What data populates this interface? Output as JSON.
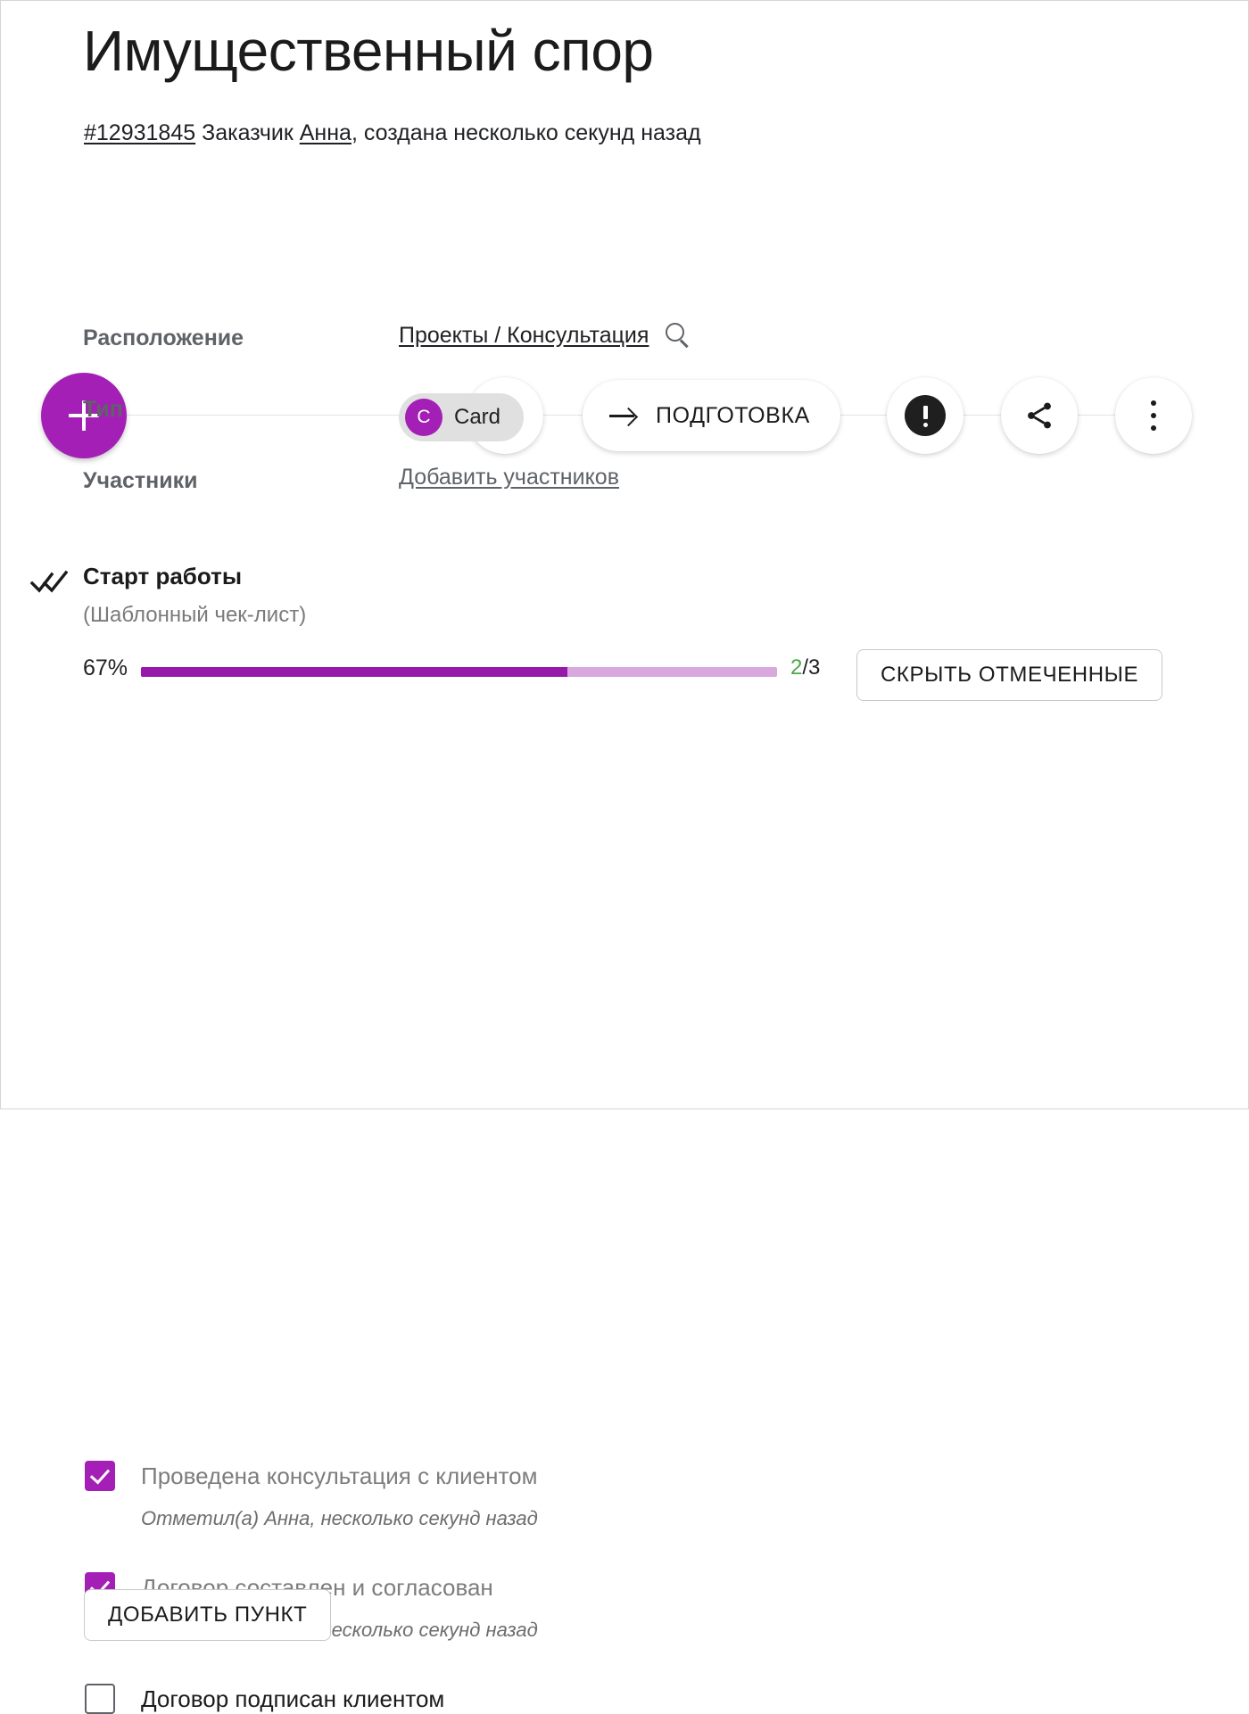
{
  "header": {
    "title": "Имущественный спор",
    "meta": {
      "id": "#12931845",
      "client_label": "Заказчик",
      "client_name": "Анна",
      "created": ", создана несколько секунд назад"
    }
  },
  "actionbar": {
    "add_button_icon": "plus-icon",
    "play_button_icon": "play-icon",
    "stage_button": {
      "icon": "arrow-right-icon",
      "label": "ПОДГОТОВКА"
    },
    "alert_button_icon": "exclamation-circle-icon",
    "share_button_icon": "share-icon",
    "more_button_icon": "more-vertical-icon"
  },
  "fields": [
    {
      "label": "Расположение",
      "value": "Проекты / Консультация",
      "icon": "search-icon"
    },
    {
      "label": "Тип",
      "chip": {
        "initial": "C",
        "label": "Card"
      }
    },
    {
      "label": "Участники",
      "value": "Добавить участников"
    }
  ],
  "checklist": {
    "icon": "double-check-icon",
    "title": "Старт работы",
    "subtitle": "(Шаблонный чек-лист)",
    "progress": {
      "percent_label": "67%",
      "percent_value": 67,
      "done": "2",
      "separator": "/3"
    },
    "hide_checked_label": "СКРЫТЬ ОТМЕЧЕННЫЕ",
    "add_item_label": "ДОБАВИТЬ ПУНКТ",
    "items": [
      {
        "text": "Проведена консультация с клиентом",
        "checked": true,
        "meta": "Отметил(а) Анна, несколько секунд назад"
      },
      {
        "text": "Договор составлен и согласован",
        "checked": true,
        "meta": "Отметил(а) Анна, несколько секунд назад"
      },
      {
        "text": "Договор подписан клиентом",
        "checked": false,
        "meta": ""
      }
    ]
  },
  "colors": {
    "accent_purple": "#a41fb5",
    "progress_fill": "#9719aa",
    "progress_track": "#d9a8de",
    "done_green": "#4aa84a",
    "chip_bg": "#e0e0e0"
  }
}
